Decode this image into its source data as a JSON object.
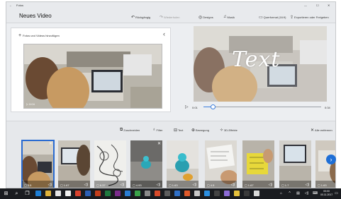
{
  "window": {
    "title_small": "Fotos",
    "title_bar_controls": [
      "—",
      "☐",
      "✕"
    ]
  },
  "header": {
    "title": "Neues Video",
    "commands": [
      {
        "name": "undo",
        "label": "Rückgängig",
        "icon": "undo-icon",
        "enabled": true
      },
      {
        "name": "redo",
        "label": "Wiederholen",
        "icon": "redo-icon",
        "enabled": false
      },
      {
        "name": "design",
        "label": "Designs",
        "icon": "palette-icon",
        "enabled": true
      },
      {
        "name": "music",
        "label": "Musik",
        "icon": "music-icon",
        "enabled": true
      },
      {
        "name": "aspect",
        "label": "Querformat (16:9)",
        "icon": "aspect-icon",
        "enabled": true
      },
      {
        "name": "finish",
        "label": "Exportieren oder Freigeben",
        "icon": "export-icon",
        "enabled": true
      }
    ]
  },
  "library": {
    "add_label": "Fotos und Videos hinzufügen",
    "thumb_duration": "0:04"
  },
  "preview": {
    "overlay_text": "Text",
    "current_time": "0:01",
    "total_time": "0:34",
    "progress": 0.08
  },
  "storyboard": {
    "tools": [
      {
        "name": "trim",
        "label": "Zuschneiden",
        "icon": "trim-icon"
      },
      {
        "name": "filters",
        "label": "Filter",
        "icon": "filter-icon"
      },
      {
        "name": "text",
        "label": "Text",
        "icon": "text-icon"
      },
      {
        "name": "motion",
        "label": "Bewegung",
        "icon": "motion-icon"
      },
      {
        "name": "3d",
        "label": "3D-Effekte",
        "icon": "effects-icon"
      }
    ],
    "remove_all": "Alle entfernen",
    "clips": [
      {
        "duration": "3.5",
        "selected": true
      },
      {
        "duration": "1.67",
        "selected": false
      },
      {
        "duration": "6.37",
        "selected": false
      },
      {
        "duration": "4.93",
        "selected": false
      },
      {
        "duration": "1.63",
        "selected": false
      },
      {
        "duration": "4.5",
        "selected": false
      },
      {
        "duration": "1.67",
        "selected": false
      },
      {
        "duration": "1.7",
        "selected": false
      },
      {
        "duration": "1.63",
        "selected": false
      }
    ]
  },
  "taskbar": {
    "clock_time": "00:00",
    "clock_date": "00.11.2017"
  },
  "colors": {
    "accent": "#2a6bd1",
    "taskbar": "#1a1c20",
    "window_bg": "#eceef1"
  }
}
